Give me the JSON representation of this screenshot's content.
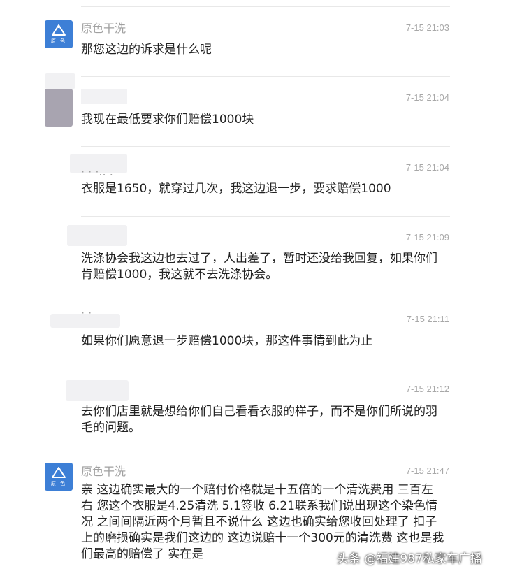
{
  "messages": [
    {
      "sender": "原色干洗",
      "time": "7-15 21:03",
      "text": "那您这边的诉求是什么呢",
      "avatar": "brand-logo"
    },
    {
      "sender": "",
      "time": "7-15 21:04",
      "text": "我现在最低要求你们赔偿1000块",
      "avatar": "blurred"
    },
    {
      "sender": "· · ·.. .",
      "time": "7-15 21:04",
      "text": "衣服是1650，就穿过几次，我这边退一步，要求赔偿1000",
      "avatar": "blurred"
    },
    {
      "sender": "",
      "time": "7-15 21:09",
      "text": "洗涤协会我这边也去过了，人出差了，暂时还没给我回复，如果你们肯赔偿1000，我这就不去洗涤协会。",
      "avatar": "blurred"
    },
    {
      "sender": "· ·",
      "time": "7-15 21:11",
      "text": "如果你们愿意退一步赔偿1000块，那这件事情到此为止",
      "avatar": "blurred"
    },
    {
      "sender": "",
      "time": "7-15 21:12",
      "text": "去你们店里就是想给你们自己看看衣服的样子，而不是你们所说的羽毛的问题。",
      "avatar": "blurred"
    },
    {
      "sender": "原色干洗",
      "time": "7-15 21:47",
      "text": "亲 这边确实最大的一个赔付价格就是十五倍的一个清洗费用 三百左右 您这个衣服是4.25清洗 5.1签收 6.21联系我们说出现这个染色情况 之间间隔近两个月暂且不说什么 这边也确实给您收回处理了 扣子上的磨损确实是我们这边的 这边说赔十一个300元的清洗费  这也是我们最高的赔偿了  实在是",
      "avatar": "brand-logo"
    }
  ],
  "brand_logo_text": "原 色",
  "watermark": "头条 @福建987私家车广播",
  "colors": {
    "brand_blue": "#3d7fd6",
    "divider": "#e8e8e8",
    "meta_gray": "#a0a0a0",
    "text": "#222222"
  }
}
